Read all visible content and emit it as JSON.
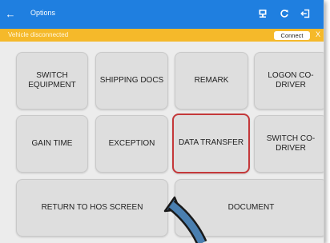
{
  "header": {
    "back_icon": "back-arrow-icon",
    "title": "Options",
    "icons": [
      "device-icon",
      "refresh-icon",
      "logout-icon"
    ],
    "color": "#1f7fe0"
  },
  "status_bar": {
    "message": "Vehicle disconnected",
    "connect_label": "Connect",
    "close_label": "X",
    "color": "#f5b92a"
  },
  "tiles": {
    "switch_equipment": "SWITCH EQUIPMENT",
    "shipping_docs": "SHIPPING DOCS",
    "remark": "REMARK",
    "logon_codriver": "LOGON CO-DRIVER",
    "gain_time": "GAIN TIME",
    "exception": "EXCEPTION",
    "data_transfer": "DATA TRANSFER",
    "switch_codriver": "SWITCH CO-DRIVER",
    "return_hos": "RETURN TO HOS SCREEN",
    "document": "DOCUMENT"
  },
  "highlight_color": "#c4383a",
  "pointer_color": "#4a7fb0"
}
